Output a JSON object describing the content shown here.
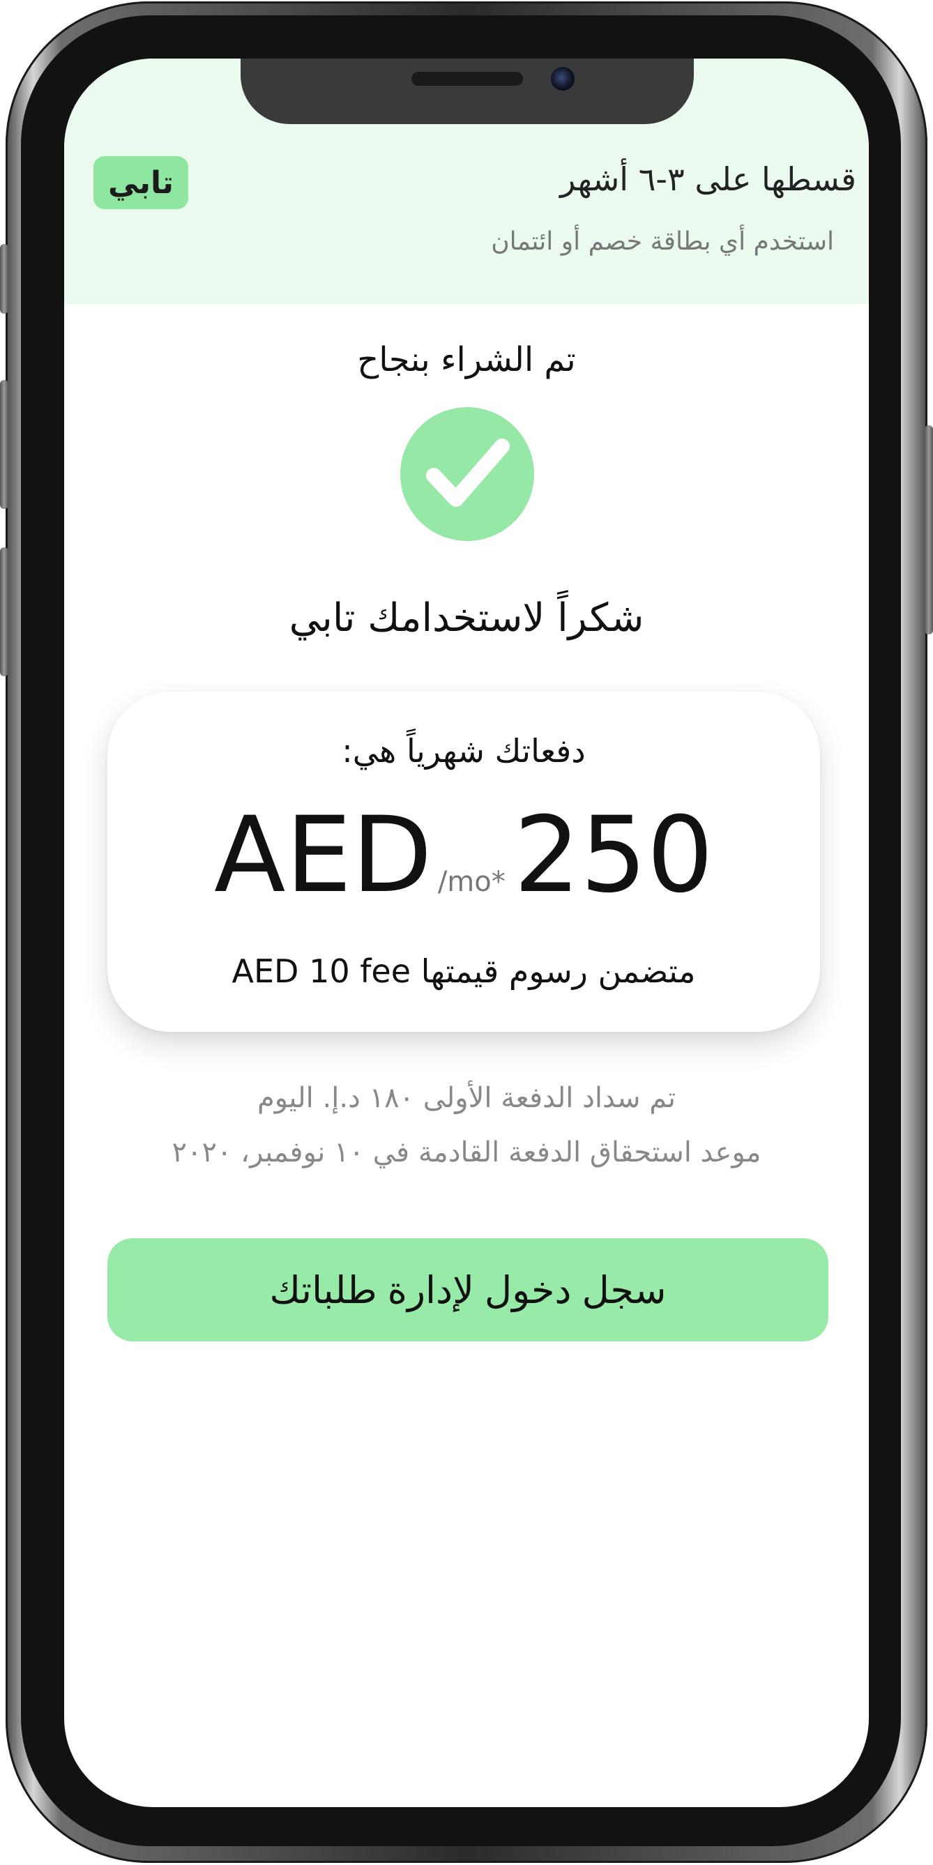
{
  "header": {
    "logo_text": "تابي",
    "title": "قسطها على ٣-٦ أشهر",
    "subtitle": "استخدم أي بطاقة خصم أو ائتمان",
    "background_color": "#ebfaee",
    "logo_color": "#8ee6a0"
  },
  "main": {
    "purchase_status": "تم الشراء بنجاح",
    "status_icon": "check-icon",
    "thanks_message": "شكراً لاستخدامك تابي",
    "card": {
      "label": "دفعاتك شهرياً هي:",
      "currency": "AED",
      "period": "/mo*",
      "amount": "250",
      "fee_note": "متضمن رسوم قيمتها AED 10 fee"
    },
    "first_payment_text": "تم سداد الدفعة الأولى ١٨٠ د.إ. اليوم",
    "next_due_text": "موعد استحقاق الدفعة القادمة في ١٠ نوفمبر، ٢٠٢٠",
    "login_button_label": "سجل دخول لإدارة طلباتك",
    "accent_color": "#98eaa9"
  }
}
